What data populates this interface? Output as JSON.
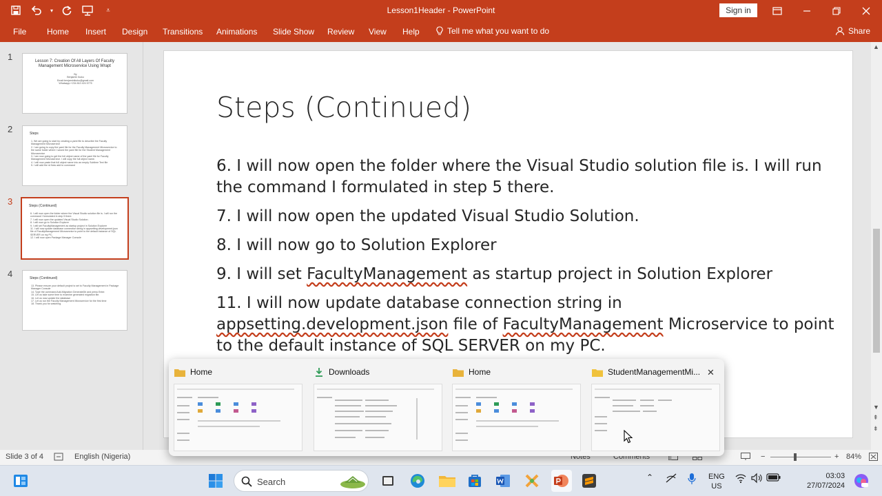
{
  "window": {
    "title": "Lesson1Header  -  PowerPoint",
    "signin_label": "Sign in",
    "qat_icons": [
      "save-icon",
      "undo-icon",
      "redo-icon",
      "present-icon",
      "customize-icon"
    ]
  },
  "ribbon": {
    "tabs": [
      "File",
      "Home",
      "Insert",
      "Design",
      "Transitions",
      "Animations",
      "Slide Show",
      "Review",
      "View",
      "Help"
    ],
    "tell_me": "Tell me what you want to do",
    "share": "Share"
  },
  "thumbnails": [
    {
      "number": "1",
      "title": "Lesson 7: Creation Of All Layers Of Faculty Management Microservice Using Wrapt",
      "lines": [
        "By",
        "Benjamin Ikuku",
        "Email:benjaminikuku@gmail.com",
        "Whatsapp:+234 810 424 5775"
      ]
    },
    {
      "number": "2",
      "title": "Steps",
      "lines": [
        "1. We are going to start by creating a yaml file to describe the Faculty Management Microservice",
        "2. I am going to copy the yaml file for the Faculty Management Microservice to the same folder where I saved the yaml file for the Student Management Microservice",
        "3. I am now going to get the full object name of the yaml file for Faculty Management Microservice. I will copy the full object name.",
        "4. I will now paste that full object name into an empty Sublime Text file",
        "5. I will add the rd fiww add to command"
      ]
    },
    {
      "number": "3",
      "title": "Steps (Continued)",
      "lines": [
        "6. I will now open the folder where the Visual Studio solution file is. I will run the command I formulated in step 5 there.",
        "7. I will now open the updated Visual Studio Solution.",
        "8. I will now go to Solution Explorer",
        "9. I will set FacultyManagement as startup project in Solution Explorer",
        "11. I will now update database connection string in appsetting.development.json file of FacultyManagement Microservice to point to the default instance of SQL SERVER on my PC.",
        "12. I will now open Package Manager Console"
      ]
    },
    {
      "number": "4",
      "title": "Steps (Continued)",
      "lines": [
        "13. Please ensure your default project is set to Faculty Management in Package Manager Console",
        "14. Type the command Add-Migration GenerateDb and press Enter.",
        "15. Let us take some time to examine generated migration file.",
        "16. Let us now update the database",
        "17. Let us run the Faculty Management Microservice for the first time",
        "18. Thank you for watching."
      ]
    }
  ],
  "slide": {
    "title": "Steps (Continued)",
    "bullets": [
      {
        "pre": "6. I will now open the folder where the Visual Studio solution file is. I will run the command I formulated in step 5 there.",
        "sq1": "",
        "mid": "",
        "sq2": "",
        "post": ""
      },
      {
        "pre": "7. I will now open the updated Visual Studio Solution.",
        "sq1": "",
        "mid": "",
        "sq2": "",
        "post": ""
      },
      {
        "pre": "8. I will now go to Solution Explorer",
        "sq1": "",
        "mid": "",
        "sq2": "",
        "post": ""
      },
      {
        "pre": "9. I will set ",
        "sq1": "FacultyManagement",
        "mid": " as startup project in Solution Explorer",
        "sq2": "",
        "post": ""
      },
      {
        "pre": "11. I will now update database connection string in ",
        "sq1": "appsetting.development.json",
        "mid": " file of ",
        "sq2": "FacultyManagement",
        "post": " Microservice to point to the default instance of SQL SERVER on my PC."
      }
    ]
  },
  "task_view": {
    "windows": [
      {
        "title": "Home",
        "icon": "folder-icon",
        "icon_color": "#e8b33b"
      },
      {
        "title": "Downloads",
        "icon": "download-icon",
        "icon_color": "#2e9b57"
      },
      {
        "title": "Home",
        "icon": "folder-icon",
        "icon_color": "#e8b33b"
      },
      {
        "title": "StudentManagementMi...",
        "icon": "folder-icon",
        "icon_color": "#f0c23c"
      }
    ],
    "close_label": "✕"
  },
  "statusbar": {
    "slide_info": "Slide 3 of 4",
    "language": "English (Nigeria)",
    "notes": "Notes",
    "comments": "Comments",
    "zoom": "84%"
  },
  "taskbar": {
    "search_label": "Search",
    "lang_line1": "ENG",
    "lang_line2": "US",
    "time": "03:03",
    "date": "27/07/2024"
  },
  "colors": {
    "accent": "#c43e1c",
    "slide_text": "#262626"
  }
}
